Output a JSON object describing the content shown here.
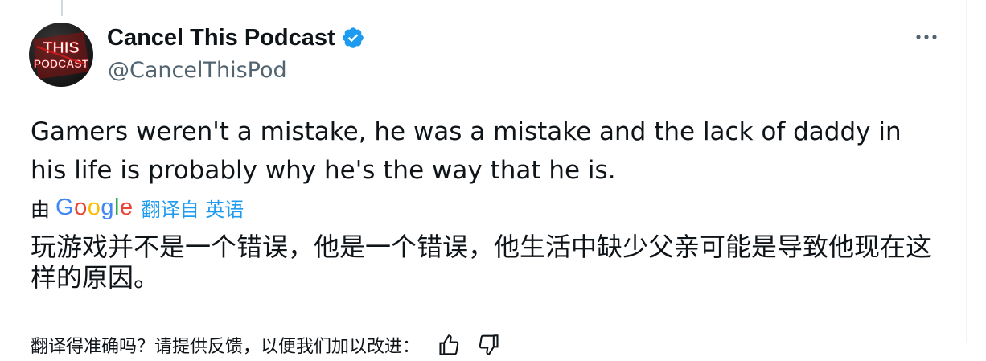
{
  "tweet": {
    "display_name": "Cancel This Podcast",
    "handle": "@CancelThisPod",
    "avatar_lines": [
      "THIS",
      "PODCAST"
    ],
    "verified_icon": "verified-badge-icon",
    "more_icon": "more-options-icon",
    "text": "Gamers weren't a mistake, he was a mistake and the lack of daddy in his life is probably why he's the way that he is."
  },
  "translation": {
    "by_label": "由",
    "provider_letters": [
      "G",
      "o",
      "o",
      "g",
      "l",
      "e"
    ],
    "link_label": "翻译自 英语",
    "translated_text": "玩游戏并不是一个错误，他是一个错误，他生活中缺少父亲可能是导致他现在这样的原因。",
    "feedback_prompt": "翻译得准确吗？请提供反馈，以便我们加以改进：",
    "thumbs_up_icon": "thumbs-up-icon",
    "thumbs_down_icon": "thumbs-down-icon"
  },
  "colors": {
    "text_primary": "#0f1419",
    "text_secondary": "#536471",
    "link": "#1d9bf0",
    "verified": "#1d9bf0",
    "border": "#eff3f4"
  }
}
